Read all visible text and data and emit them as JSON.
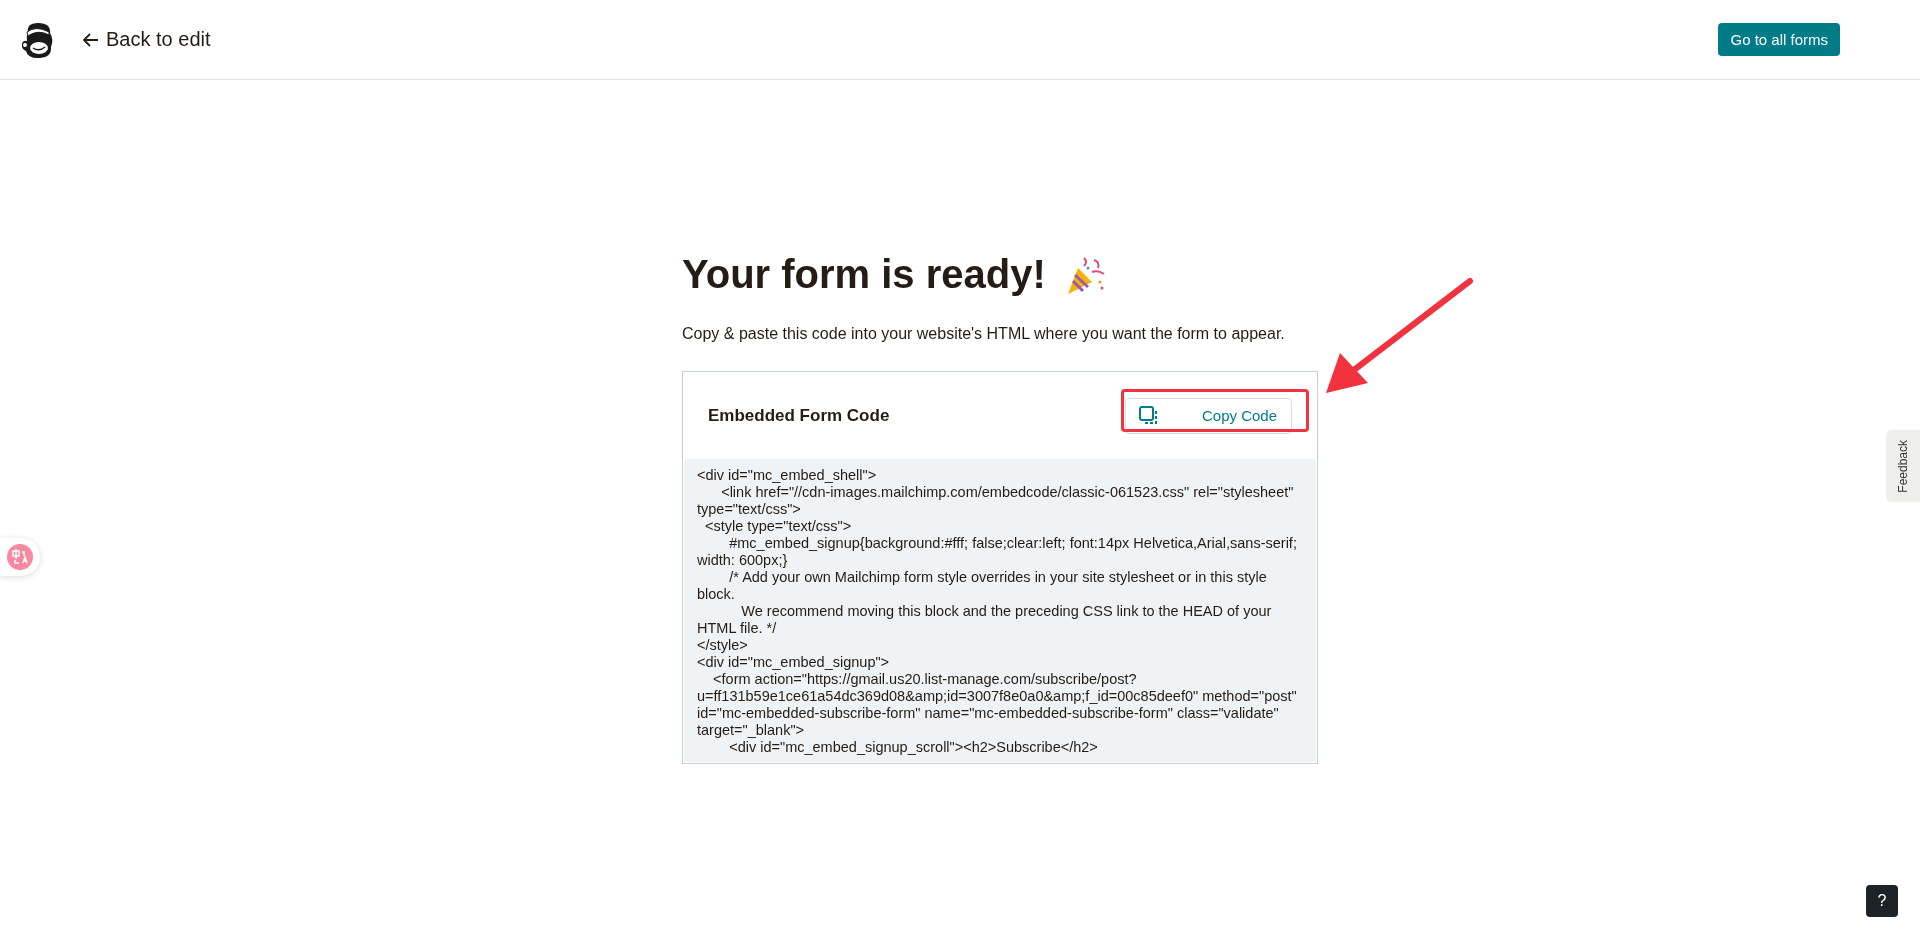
{
  "header": {
    "back_link": "Back to edit",
    "primary_button": "Go to all forms"
  },
  "main": {
    "title": "Your form is ready!",
    "subtitle": "Copy & paste this code into your website's HTML where you want the form to appear.",
    "code_card": {
      "title": "Embedded Form Code",
      "copy_button": "Copy Code",
      "lines": [
        "<div id=\"mc_embed_shell\">",
        "      <link href=\"//cdn-images.mailchimp.com/embedcode/classic-061523.css\" rel=\"stylesheet\"",
        "type=\"text/css\">",
        "  <style type=\"text/css\">",
        "        #mc_embed_signup{background:#fff; false;clear:left; font:14px Helvetica,Arial,sans-serif;",
        "width: 600px;}",
        "        /* Add your own Mailchimp form style overrides in your site stylesheet or in this style",
        "block.",
        "           We recommend moving this block and the preceding CSS link to the HEAD of your",
        "HTML file. */",
        "</style>",
        "<div id=\"mc_embed_signup\">",
        "    <form action=\"https://gmail.us20.list-manage.com/subscribe/post?",
        "u=ff131b59e1ce61a54dc369d08&amp;id=3007f8e0a0&amp;f_id=00c85deef0\" method=\"post\"",
        "id=\"mc-embedded-subscribe-form\" name=\"mc-embedded-subscribe-form\" class=\"validate\"",
        "target=\"_blank\">",
        "        <div id=\"mc_embed_signup_scroll\"><h2>Subscribe</h2>"
      ]
    }
  },
  "feedback_tab": "Feedback",
  "help_button": "?"
}
